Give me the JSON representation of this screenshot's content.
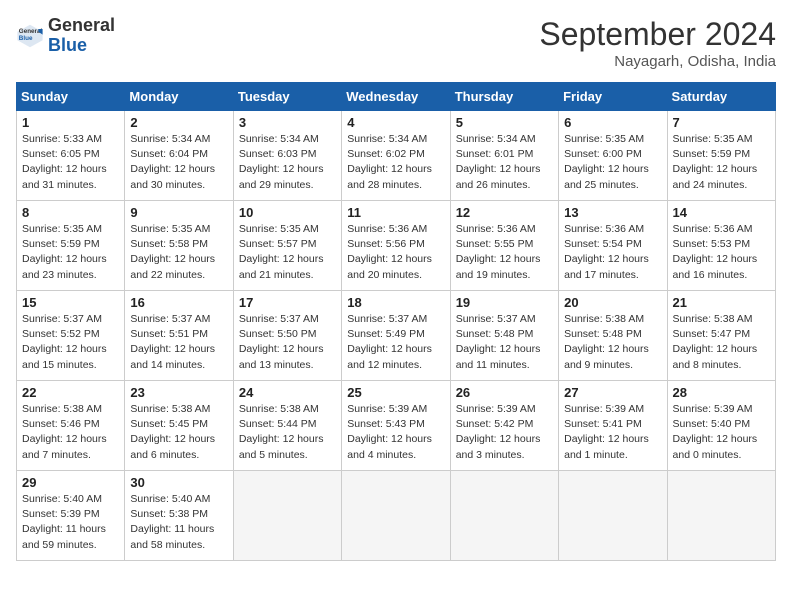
{
  "header": {
    "logo_general": "General",
    "logo_blue": "Blue",
    "month_title": "September 2024",
    "location": "Nayagarh, Odisha, India"
  },
  "weekdays": [
    "Sunday",
    "Monday",
    "Tuesday",
    "Wednesday",
    "Thursday",
    "Friday",
    "Saturday"
  ],
  "weeks": [
    [
      {
        "day": "1",
        "sunrise": "5:33 AM",
        "sunset": "6:05 PM",
        "daylight": "12 hours and 31 minutes."
      },
      {
        "day": "2",
        "sunrise": "5:34 AM",
        "sunset": "6:04 PM",
        "daylight": "12 hours and 30 minutes."
      },
      {
        "day": "3",
        "sunrise": "5:34 AM",
        "sunset": "6:03 PM",
        "daylight": "12 hours and 29 minutes."
      },
      {
        "day": "4",
        "sunrise": "5:34 AM",
        "sunset": "6:02 PM",
        "daylight": "12 hours and 28 minutes."
      },
      {
        "day": "5",
        "sunrise": "5:34 AM",
        "sunset": "6:01 PM",
        "daylight": "12 hours and 26 minutes."
      },
      {
        "day": "6",
        "sunrise": "5:35 AM",
        "sunset": "6:00 PM",
        "daylight": "12 hours and 25 minutes."
      },
      {
        "day": "7",
        "sunrise": "5:35 AM",
        "sunset": "5:59 PM",
        "daylight": "12 hours and 24 minutes."
      }
    ],
    [
      {
        "day": "8",
        "sunrise": "5:35 AM",
        "sunset": "5:59 PM",
        "daylight": "12 hours and 23 minutes."
      },
      {
        "day": "9",
        "sunrise": "5:35 AM",
        "sunset": "5:58 PM",
        "daylight": "12 hours and 22 minutes."
      },
      {
        "day": "10",
        "sunrise": "5:35 AM",
        "sunset": "5:57 PM",
        "daylight": "12 hours and 21 minutes."
      },
      {
        "day": "11",
        "sunrise": "5:36 AM",
        "sunset": "5:56 PM",
        "daylight": "12 hours and 20 minutes."
      },
      {
        "day": "12",
        "sunrise": "5:36 AM",
        "sunset": "5:55 PM",
        "daylight": "12 hours and 19 minutes."
      },
      {
        "day": "13",
        "sunrise": "5:36 AM",
        "sunset": "5:54 PM",
        "daylight": "12 hours and 17 minutes."
      },
      {
        "day": "14",
        "sunrise": "5:36 AM",
        "sunset": "5:53 PM",
        "daylight": "12 hours and 16 minutes."
      }
    ],
    [
      {
        "day": "15",
        "sunrise": "5:37 AM",
        "sunset": "5:52 PM",
        "daylight": "12 hours and 15 minutes."
      },
      {
        "day": "16",
        "sunrise": "5:37 AM",
        "sunset": "5:51 PM",
        "daylight": "12 hours and 14 minutes."
      },
      {
        "day": "17",
        "sunrise": "5:37 AM",
        "sunset": "5:50 PM",
        "daylight": "12 hours and 13 minutes."
      },
      {
        "day": "18",
        "sunrise": "5:37 AM",
        "sunset": "5:49 PM",
        "daylight": "12 hours and 12 minutes."
      },
      {
        "day": "19",
        "sunrise": "5:37 AM",
        "sunset": "5:48 PM",
        "daylight": "12 hours and 11 minutes."
      },
      {
        "day": "20",
        "sunrise": "5:38 AM",
        "sunset": "5:48 PM",
        "daylight": "12 hours and 9 minutes."
      },
      {
        "day": "21",
        "sunrise": "5:38 AM",
        "sunset": "5:47 PM",
        "daylight": "12 hours and 8 minutes."
      }
    ],
    [
      {
        "day": "22",
        "sunrise": "5:38 AM",
        "sunset": "5:46 PM",
        "daylight": "12 hours and 7 minutes."
      },
      {
        "day": "23",
        "sunrise": "5:38 AM",
        "sunset": "5:45 PM",
        "daylight": "12 hours and 6 minutes."
      },
      {
        "day": "24",
        "sunrise": "5:38 AM",
        "sunset": "5:44 PM",
        "daylight": "12 hours and 5 minutes."
      },
      {
        "day": "25",
        "sunrise": "5:39 AM",
        "sunset": "5:43 PM",
        "daylight": "12 hours and 4 minutes."
      },
      {
        "day": "26",
        "sunrise": "5:39 AM",
        "sunset": "5:42 PM",
        "daylight": "12 hours and 3 minutes."
      },
      {
        "day": "27",
        "sunrise": "5:39 AM",
        "sunset": "5:41 PM",
        "daylight": "12 hours and 1 minute."
      },
      {
        "day": "28",
        "sunrise": "5:39 AM",
        "sunset": "5:40 PM",
        "daylight": "12 hours and 0 minutes."
      }
    ],
    [
      {
        "day": "29",
        "sunrise": "5:40 AM",
        "sunset": "5:39 PM",
        "daylight": "11 hours and 59 minutes."
      },
      {
        "day": "30",
        "sunrise": "5:40 AM",
        "sunset": "5:38 PM",
        "daylight": "11 hours and 58 minutes."
      },
      null,
      null,
      null,
      null,
      null
    ]
  ]
}
